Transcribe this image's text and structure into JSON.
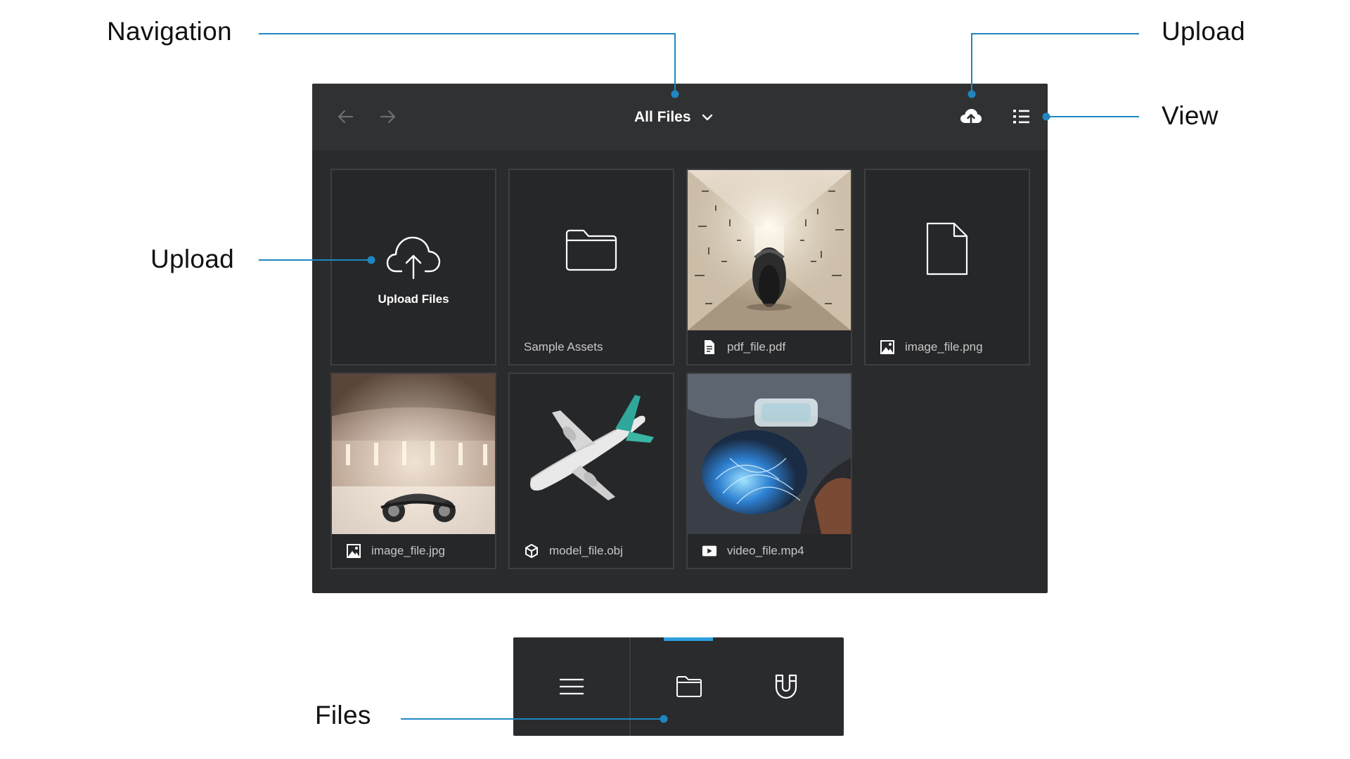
{
  "callouts": {
    "navigation": "Navigation",
    "upload_top": "Upload",
    "view": "View",
    "upload_left": "Upload",
    "files": "Files"
  },
  "toolbar": {
    "back_icon": "arrow-left-icon",
    "forward_icon": "arrow-right-icon",
    "location_label": "All Files",
    "location_dropdown_icon": "chevron-down-icon",
    "upload_icon": "cloud-upload-icon",
    "view_icon": "list-view-icon"
  },
  "tiles": [
    {
      "kind": "upload",
      "label": "Upload Files",
      "icon": "cloud-upload-icon"
    },
    {
      "kind": "folder",
      "label": "Sample Assets",
      "icon": "folder-icon"
    },
    {
      "kind": "file",
      "label": "pdf_file.pdf",
      "icon": "document-icon"
    },
    {
      "kind": "file",
      "label": "image_file.png",
      "icon": "image-icon"
    },
    {
      "kind": "file",
      "label": "image_file.jpg",
      "icon": "image-icon"
    },
    {
      "kind": "file",
      "label": "model_file.obj",
      "icon": "cube-icon"
    },
    {
      "kind": "file",
      "label": "video_file.mp4",
      "icon": "play-icon"
    }
  ],
  "tabbar": {
    "tabs": [
      {
        "icon": "menu-icon",
        "active": false
      },
      {
        "icon": "folder-icon",
        "active": true
      },
      {
        "icon": "magnet-icon",
        "active": false
      }
    ]
  },
  "colors": {
    "accent": "#2ba0df",
    "panel_bg": "#2a2b2d",
    "toolbar_bg": "#303133",
    "tile_border": "#3e3f42",
    "callout_line": "#1f86c1"
  }
}
